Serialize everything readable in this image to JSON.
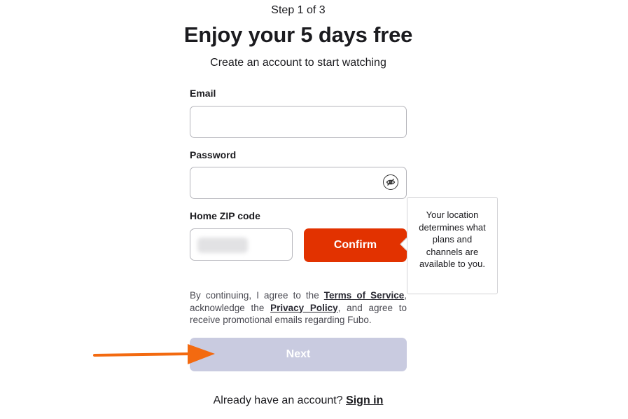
{
  "header": {
    "step": "Step 1 of 3",
    "title": "Enjoy your 5 days free",
    "subtitle": "Create an account to start watching"
  },
  "form": {
    "email_label": "Email",
    "email_value": "",
    "password_label": "Password",
    "password_value": "",
    "zip_label": "Home ZIP code",
    "confirm_label": "Confirm"
  },
  "tooltip": {
    "text": "Your location determines what plans and channels are available to you."
  },
  "legal": {
    "part1": "By continuing, I agree to the ",
    "terms_link": "Terms of Service",
    "part2": ", acknowledge the ",
    "privacy_link": "Privacy Policy",
    "part3": ", and agree to receive promotional emails regarding Fubo."
  },
  "next_label": "Next",
  "footer": {
    "prompt": "Already have an account? ",
    "signin_link": "Sign in"
  },
  "colors": {
    "confirm_bg": "#e23200",
    "next_disabled_bg": "#c9cbe0",
    "annotation_arrow": "#f36a10"
  },
  "icons": {
    "password_toggle": "eye-slash-icon",
    "annotation": "arrow-right-icon"
  }
}
